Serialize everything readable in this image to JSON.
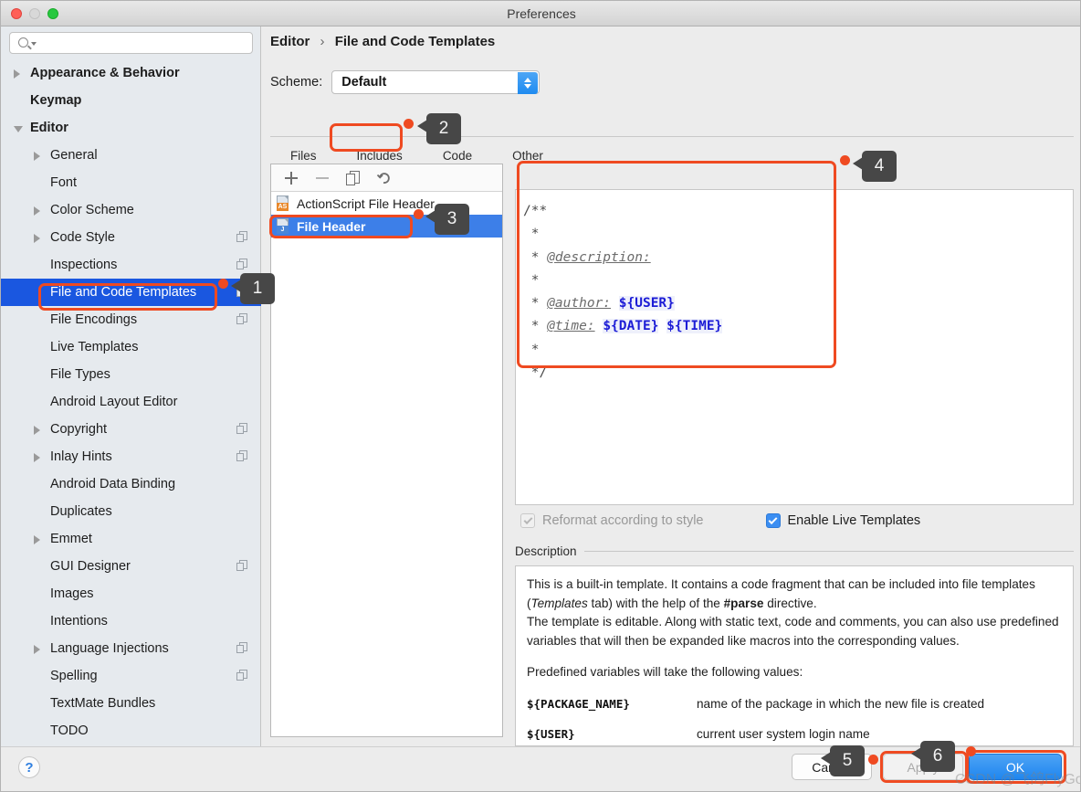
{
  "window": {
    "title": "Preferences",
    "traffic_lights": [
      "close",
      "minimize",
      "zoom"
    ]
  },
  "sidebar": {
    "search_placeholder": "",
    "search_value": "",
    "items": [
      {
        "label": "Appearance & Behavior",
        "level": 0,
        "twisty": "closed",
        "bold": true,
        "selected": false,
        "badge": false
      },
      {
        "label": "Keymap",
        "level": 0,
        "twisty": "none",
        "bold": true,
        "selected": false,
        "badge": false
      },
      {
        "label": "Editor",
        "level": 0,
        "twisty": "open",
        "bold": true,
        "selected": false,
        "badge": false
      },
      {
        "label": "General",
        "level": 1,
        "twisty": "closed",
        "bold": false,
        "selected": false,
        "badge": false
      },
      {
        "label": "Font",
        "level": 1,
        "twisty": "none",
        "bold": false,
        "selected": false,
        "badge": false
      },
      {
        "label": "Color Scheme",
        "level": 1,
        "twisty": "closed",
        "bold": false,
        "selected": false,
        "badge": false
      },
      {
        "label": "Code Style",
        "level": 1,
        "twisty": "closed",
        "bold": false,
        "selected": false,
        "badge": true
      },
      {
        "label": "Inspections",
        "level": 1,
        "twisty": "none",
        "bold": false,
        "selected": false,
        "badge": true
      },
      {
        "label": "File and Code Templates",
        "level": 1,
        "twisty": "none",
        "bold": false,
        "selected": true,
        "badge": true
      },
      {
        "label": "File Encodings",
        "level": 1,
        "twisty": "none",
        "bold": false,
        "selected": false,
        "badge": true
      },
      {
        "label": "Live Templates",
        "level": 1,
        "twisty": "none",
        "bold": false,
        "selected": false,
        "badge": false
      },
      {
        "label": "File Types",
        "level": 1,
        "twisty": "none",
        "bold": false,
        "selected": false,
        "badge": false
      },
      {
        "label": "Android Layout Editor",
        "level": 1,
        "twisty": "none",
        "bold": false,
        "selected": false,
        "badge": false
      },
      {
        "label": "Copyright",
        "level": 1,
        "twisty": "closed",
        "bold": false,
        "selected": false,
        "badge": true
      },
      {
        "label": "Inlay Hints",
        "level": 1,
        "twisty": "closed",
        "bold": false,
        "selected": false,
        "badge": true
      },
      {
        "label": "Android Data Binding",
        "level": 1,
        "twisty": "none",
        "bold": false,
        "selected": false,
        "badge": false
      },
      {
        "label": "Duplicates",
        "level": 1,
        "twisty": "none",
        "bold": false,
        "selected": false,
        "badge": false
      },
      {
        "label": "Emmet",
        "level": 1,
        "twisty": "closed",
        "bold": false,
        "selected": false,
        "badge": false
      },
      {
        "label": "GUI Designer",
        "level": 1,
        "twisty": "none",
        "bold": false,
        "selected": false,
        "badge": true
      },
      {
        "label": "Images",
        "level": 1,
        "twisty": "none",
        "bold": false,
        "selected": false,
        "badge": false
      },
      {
        "label": "Intentions",
        "level": 1,
        "twisty": "none",
        "bold": false,
        "selected": false,
        "badge": false
      },
      {
        "label": "Language Injections",
        "level": 1,
        "twisty": "closed",
        "bold": false,
        "selected": false,
        "badge": true
      },
      {
        "label": "Spelling",
        "level": 1,
        "twisty": "none",
        "bold": false,
        "selected": false,
        "badge": true
      },
      {
        "label": "TextMate Bundles",
        "level": 1,
        "twisty": "none",
        "bold": false,
        "selected": false,
        "badge": false
      },
      {
        "label": "TODO",
        "level": 1,
        "twisty": "none",
        "bold": false,
        "selected": false,
        "badge": false
      }
    ]
  },
  "main": {
    "breadcrumb": {
      "root": "Editor",
      "separator": "›",
      "leaf": "File and Code Templates"
    },
    "scheme": {
      "label": "Scheme:",
      "value": "Default"
    },
    "tabs": [
      {
        "label": "Files",
        "active": false
      },
      {
        "label": "Includes",
        "active": true
      },
      {
        "label": "Code",
        "active": false
      },
      {
        "label": "Other",
        "active": false
      }
    ],
    "list_toolbar": [
      {
        "name": "add-icon",
        "glyph": "+"
      },
      {
        "name": "remove-icon",
        "glyph": "−"
      },
      {
        "name": "copy-icon",
        "glyph": "⧉"
      },
      {
        "name": "reset-icon",
        "glyph": "↺"
      }
    ],
    "templates": [
      {
        "label": "ActionScript File Header",
        "icon": "as",
        "icon_text": "AS",
        "selected": false
      },
      {
        "label": "File Header",
        "icon": "j",
        "icon_text": "J",
        "selected": true
      }
    ],
    "editor_code": {
      "lines": [
        [
          {
            "t": "/**",
            "k": "kw"
          }
        ],
        [
          {
            "t": " *",
            "k": "kw"
          }
        ],
        [
          {
            "t": " * ",
            "k": "kw"
          },
          {
            "t": "@description:",
            "k": "tag"
          }
        ],
        [
          {
            "t": " *",
            "k": "kw"
          }
        ],
        [
          {
            "t": " * ",
            "k": "kw"
          },
          {
            "t": "@author:",
            "k": "tag"
          },
          {
            "t": " ",
            "k": "kw"
          },
          {
            "t": "${USER}",
            "k": "var"
          }
        ],
        [
          {
            "t": " * ",
            "k": "kw"
          },
          {
            "t": "@time:",
            "k": "tag"
          },
          {
            "t": " ",
            "k": "kw"
          },
          {
            "t": "${DATE}",
            "k": "var"
          },
          {
            "t": " ",
            "k": "kw"
          },
          {
            "t": "${TIME}",
            "k": "var"
          }
        ],
        [
          {
            "t": " *",
            "k": "kw"
          }
        ],
        [
          {
            "t": " */",
            "k": "kw"
          }
        ]
      ]
    },
    "checkboxes": [
      {
        "label": "Reformat according to style",
        "checked": true,
        "enabled": false
      },
      {
        "label": "Enable Live Templates",
        "checked": true,
        "enabled": true
      }
    ],
    "description": {
      "title": "Description",
      "paragraphs": [
        {
          "parts": [
            {
              "t": "This is a built-in template. It contains a code fragment that can be included into file templates (",
              "s": "n"
            },
            {
              "t": "Templates",
              "s": "i"
            },
            {
              "t": " tab) with the help of the ",
              "s": "n"
            },
            {
              "t": "#parse",
              "s": "b"
            },
            {
              "t": " directive.",
              "s": "n"
            }
          ]
        },
        {
          "parts": [
            {
              "t": "The template is editable. Along with static text, code and comments, you can also use predefined variables that will then be expanded like macros into the corresponding values.",
              "s": "n"
            }
          ]
        },
        {
          "parts": [
            {
              "t": "Predefined variables will take the following values:",
              "s": "n"
            }
          ]
        }
      ],
      "variables": [
        {
          "name": "${PACKAGE_NAME}",
          "desc": "name of the package in which the new file is created"
        },
        {
          "name": "${USER}",
          "desc": "current user system login name"
        }
      ]
    }
  },
  "footer": {
    "help_label": "?",
    "cancel_label": "Cancel",
    "apply_label": "Apply",
    "ok_label": "OK"
  },
  "annotations": {
    "markers": [
      {
        "id": "1",
        "target": "sidebar-item-file-and-code-templates"
      },
      {
        "id": "2",
        "target": "tab-includes"
      },
      {
        "id": "3",
        "target": "template-file-header"
      },
      {
        "id": "4",
        "target": "template-editor"
      },
      {
        "id": "5",
        "target": "cancel-button"
      },
      {
        "id": "6",
        "target": "apply-button"
      }
    ],
    "accent_color": "#ef4a21",
    "tag_color": "#474747"
  },
  "watermark": {
    "text": "CSDN @飞鸽FlyGo"
  }
}
